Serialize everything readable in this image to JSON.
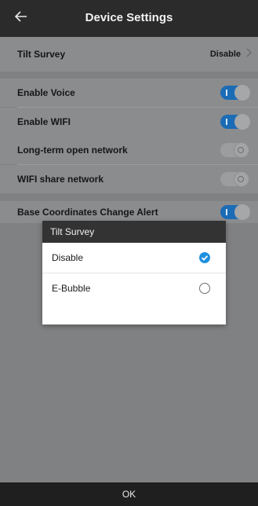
{
  "header": {
    "title": "Device Settings",
    "back_icon": "arrow-left-icon"
  },
  "settings": {
    "tilt_survey": {
      "label": "Tilt Survey",
      "value": "Disable",
      "icon": "chevron-right-icon"
    },
    "enable_voice": {
      "label": "Enable Voice",
      "state": "on"
    },
    "enable_wifi": {
      "label": "Enable WIFI",
      "state": "on"
    },
    "long_term_open_network": {
      "label": "Long-term open network",
      "state": "off"
    },
    "wifi_share_network": {
      "label": "WIFI share network",
      "state": "off"
    },
    "base_coordinates_alert": {
      "label": "Base Coordinates Change Alert",
      "state": "on"
    }
  },
  "dialog": {
    "title": "Tilt Survey",
    "options": [
      {
        "label": "Disable",
        "selected": true
      },
      {
        "label": "E-Bubble",
        "selected": false
      }
    ]
  },
  "footer": {
    "ok_label": "OK"
  },
  "colors": {
    "accent": "#1f8fe0",
    "toggle_on": "#1b6cb5",
    "header": "#2b2b2b"
  }
}
